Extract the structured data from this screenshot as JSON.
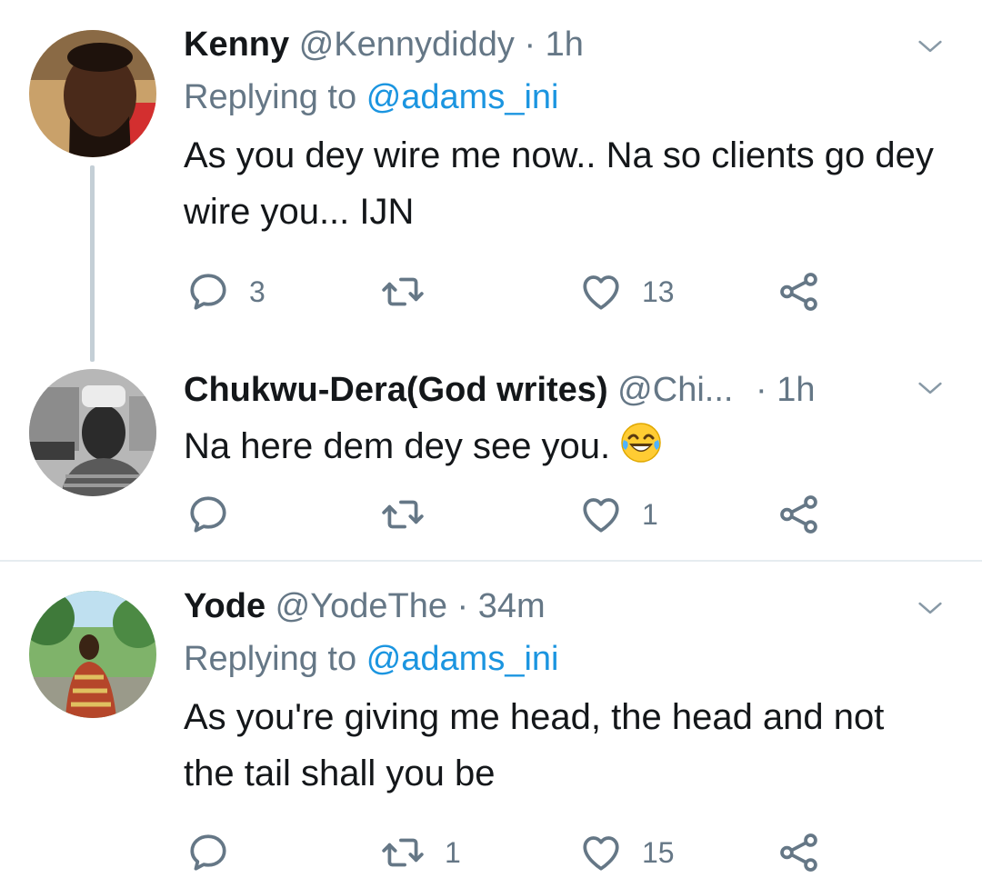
{
  "tweets": [
    {
      "name": "Kenny",
      "handle": "@Kennydiddy",
      "dot": "·",
      "time": "1h",
      "replying_prefix": "Replying to",
      "replying_to": "@adams_ini",
      "text": "As you dey wire me now.. Na so clients go dey wire you... IJN",
      "reply_count": "3",
      "retweet_count": "",
      "like_count": "13"
    },
    {
      "name": "Chukwu-Dera(God writes)",
      "handle": "@Chi...",
      "dot": "·",
      "time": "1h",
      "text": "Na here dem dey see you.",
      "emoji": "face-with-tears-of-joy",
      "reply_count": "",
      "retweet_count": "",
      "like_count": "1"
    },
    {
      "name": "Yode",
      "handle": "@YodeThe",
      "dot": "·",
      "time": "34m",
      "replying_prefix": "Replying to",
      "replying_to": "@adams_ini",
      "text": "As you're giving me head, the head and not the tail shall you be",
      "reply_count": "",
      "retweet_count": "1",
      "like_count": "15"
    }
  ],
  "icons": {
    "reply": "reply-icon",
    "retweet": "retweet-icon",
    "like": "heart-icon",
    "share": "share-icon",
    "more": "chevron-down-icon"
  },
  "colors": {
    "text": "#14171a",
    "secondary": "#657786",
    "link": "#1b95e0",
    "thread_line": "#c4cfd6",
    "divider": "#e6ecf0"
  }
}
